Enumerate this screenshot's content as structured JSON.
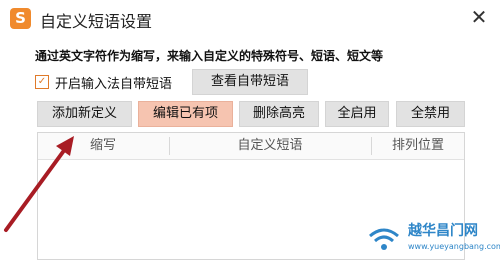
{
  "window": {
    "title": "自定义短语设置",
    "app_logo_letter": "S",
    "close_glyph": "✕",
    "accent": "#f08a2d"
  },
  "description": "通过英文字符作为缩写，来输入自定义的特殊符号、短语、短文等",
  "checkbox": {
    "label": "开启输入法自带短语",
    "checked": true,
    "check_glyph": "✓"
  },
  "buttons": {
    "view_builtin": "查看自带短语",
    "add_new": "添加新定义",
    "edit_existing": "编辑已有项",
    "delete_highlight": "删除高亮",
    "enable_all": "全启用",
    "disable_all": "全禁用"
  },
  "table": {
    "columns": [
      "缩写",
      "自定义短语",
      "排列位置"
    ],
    "rows": []
  },
  "watermark": {
    "text": "越华昌门网",
    "url": "www.yueyangbang.com"
  },
  "colors": {
    "highlight_button": "#f6c4b0",
    "arrow": "#a81c24"
  }
}
